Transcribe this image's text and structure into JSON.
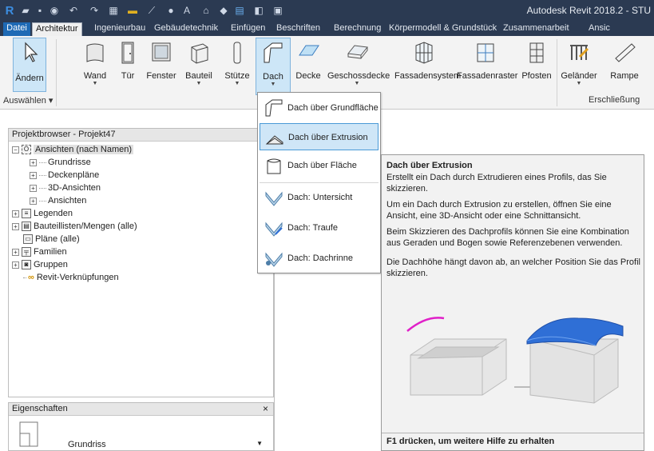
{
  "app": {
    "title": "Autodesk Revit 2018.2 - STU"
  },
  "tabs": [
    "Datei",
    "Architektur",
    "Ingenieurbau",
    "Gebäudetechnik",
    "Einfügen",
    "Beschriften",
    "Berechnung",
    "Körpermodell & Grundstück",
    "Zusammenarbeit",
    "Ansic"
  ],
  "ribbon": {
    "modify": "Ändern",
    "wall": "Wand",
    "door": "Tür",
    "window": "Fenster",
    "component": "Bauteil",
    "column": "Stütze",
    "roof": "Dach",
    "ceiling": "Decke",
    "floor": "Geschossdecke",
    "curtain_system": "Fassadensystem",
    "curtain_grid": "Fassadenraster",
    "mullion": "Pfosten",
    "railing": "Geländer",
    "ramp": "Rampe",
    "select_group": "Auswählen ▾",
    "circulation_group": "Erschließung"
  },
  "dropdown": {
    "items": [
      "Dach über Grundfläche",
      "Dach über Extrusion",
      "Dach über Fläche",
      "Dach: Untersicht",
      "Dach: Traufe",
      "Dach: Dachrinne"
    ]
  },
  "project_browser": {
    "title": "Projektbrowser - Projekt47",
    "views_root": "Ansichten (nach Namen)",
    "floor_plans": "Grundrisse",
    "ceiling_plans": "Deckenpläne",
    "views_3d": "3D-Ansichten",
    "elevations": "Ansichten",
    "legends": "Legenden",
    "schedules": "Bauteillisten/Mengen (alle)",
    "sheets": "Pläne (alle)",
    "families": "Familien",
    "groups": "Gruppen",
    "revit_links": "Revit-Verknüpfungen"
  },
  "properties": {
    "title": "Eigenschaften",
    "close": "×",
    "type": "Grundriss"
  },
  "tooltip": {
    "title": "Dach über Extrusion",
    "line1": "Erstellt ein Dach durch Extrudieren eines Profils, das Sie skizzieren.",
    "para1": "Um ein Dach durch Extrusion zu erstellen, öffnen Sie eine Ansicht, eine 3D-Ansicht oder eine Schnittansicht.",
    "para2": "Beim Skizzieren des Dachprofils können Sie eine Kombination aus Geraden und Bogen sowie Referenzebenen verwenden.",
    "para3": "Die Dachhöhe hängt davon ab, an welcher Position Sie das Profil skizzieren.",
    "footer": "F1 drücken, um weitere Hilfe zu erhalten"
  },
  "colors": {
    "titlebar": "#2b3a52",
    "accent": "#1e6ab5",
    "highlight": "#cfe6f7",
    "roof_blue": "#2f6fd6",
    "profile_magenta": "#e020c8"
  }
}
